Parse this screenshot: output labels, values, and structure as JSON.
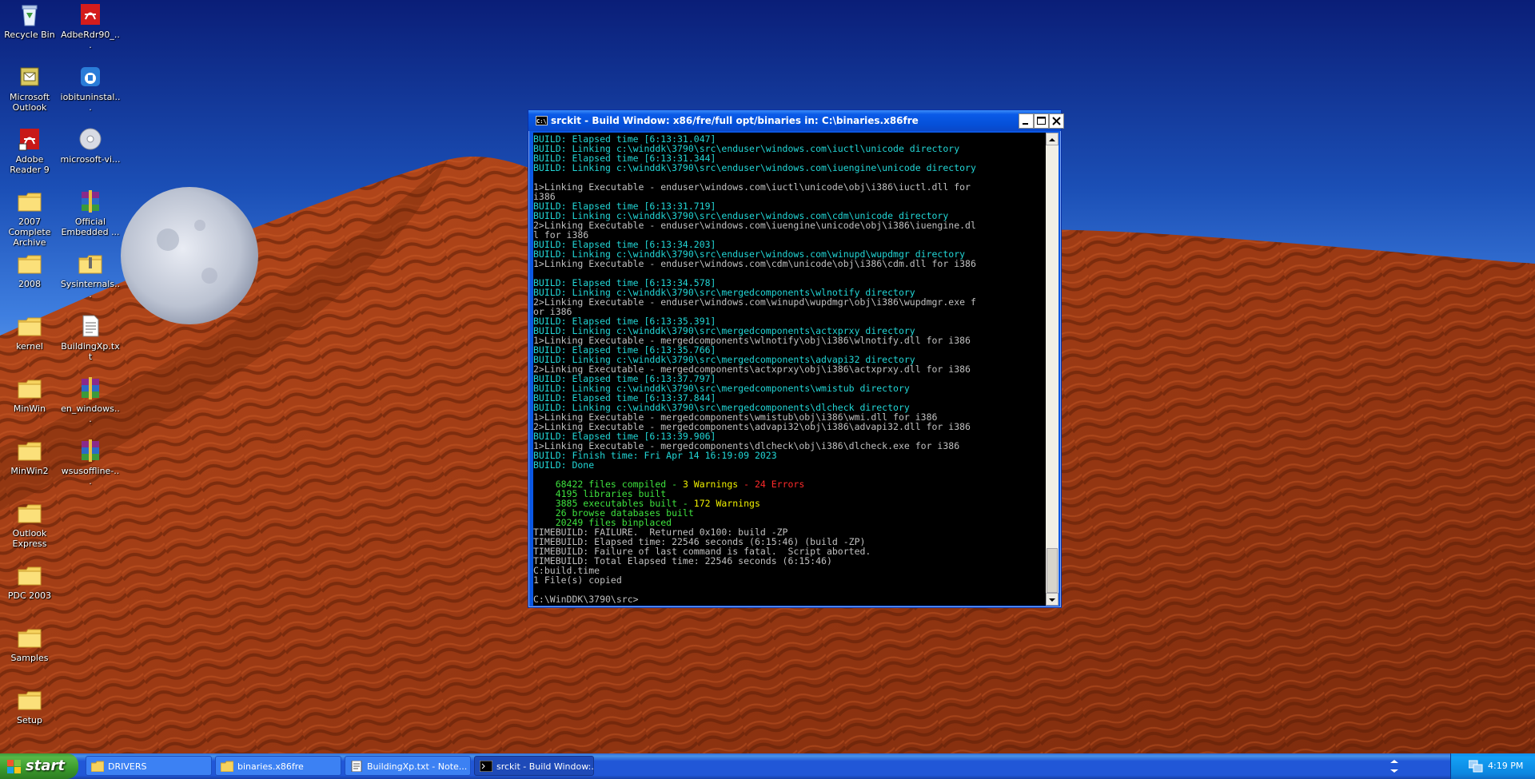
{
  "desktop": {
    "icons": [
      {
        "label": "Recycle Bin",
        "icon": "recycle-bin-icon"
      },
      {
        "label": "AdbeRdr90_...",
        "icon": "adobe-installer-icon"
      },
      {
        "label": "Microsoft Outlook",
        "icon": "outlook-icon"
      },
      {
        "label": "iobituninstal...",
        "icon": "iobit-icon"
      },
      {
        "label": "Adobe Reader 9",
        "icon": "adobe-reader-icon"
      },
      {
        "label": "microsoft-vi...",
        "icon": "disc-image-icon"
      },
      {
        "label": "2007 Complete Archive",
        "icon": "folder-icon"
      },
      {
        "label": "Official Embedded ...",
        "icon": "winrar-archive-icon"
      },
      {
        "label": "2008",
        "icon": "folder-icon"
      },
      {
        "label": "Sysinternals...",
        "icon": "zip-folder-icon"
      },
      {
        "label": "kernel",
        "icon": "folder-icon"
      },
      {
        "label": "BuildingXp.txt",
        "icon": "text-file-icon"
      },
      {
        "label": "MinWin",
        "icon": "folder-icon"
      },
      {
        "label": "en_windows...",
        "icon": "winrar-archive-icon"
      },
      {
        "label": "MinWin2",
        "icon": "folder-icon"
      },
      {
        "label": "wsusoffline-...",
        "icon": "winrar-archive-icon"
      },
      {
        "label": "Outlook Express",
        "icon": "folder-icon"
      },
      {
        "label": "PDC 2003",
        "icon": "folder-icon"
      },
      {
        "label": "Samples",
        "icon": "folder-icon"
      },
      {
        "label": "Setup",
        "icon": "folder-icon"
      }
    ]
  },
  "window": {
    "title": "srckit - Build Window: x86/fre/full opt/binaries in: C:\\binaries.x86fre",
    "icon_text": "C:\\",
    "console_lines": [
      {
        "t": "BUILD: Elapsed time [6:13:31.047]",
        "c": "cyan"
      },
      {
        "t": "BUILD: Linking c:\\winddk\\3790\\src\\enduser\\windows.com\\iuctl\\unicode directory",
        "c": "cyan"
      },
      {
        "t": "BUILD: Elapsed time [6:13:31.344]",
        "c": "cyan"
      },
      {
        "t": "BUILD: Linking c:\\winddk\\3790\\src\\enduser\\windows.com\\iuengine\\unicode directory",
        "c": "cyan"
      },
      {
        "t": "",
        "c": "gray"
      },
      {
        "t": "1>Linking Executable - enduser\\windows.com\\iuctl\\unicode\\obj\\i386\\iuctl.dll for",
        "c": "gray"
      },
      {
        "t": "i386",
        "c": "gray"
      },
      {
        "t": "BUILD: Elapsed time [6:13:31.719]",
        "c": "cyan"
      },
      {
        "t": "BUILD: Linking c:\\winddk\\3790\\src\\enduser\\windows.com\\cdm\\unicode directory",
        "c": "cyan"
      },
      {
        "t": "2>Linking Executable - enduser\\windows.com\\iuengine\\unicode\\obj\\i386\\iuengine.dl",
        "c": "gray"
      },
      {
        "t": "l for i386",
        "c": "gray"
      },
      {
        "t": "BUILD: Elapsed time [6:13:34.203]",
        "c": "cyan"
      },
      {
        "t": "BUILD: Linking c:\\winddk\\3790\\src\\enduser\\windows.com\\winupd\\wupdmgr directory",
        "c": "cyan"
      },
      {
        "t": "1>Linking Executable - enduser\\windows.com\\cdm\\unicode\\obj\\i386\\cdm.dll for i386",
        "c": "gray"
      },
      {
        "t": "",
        "c": "gray"
      },
      {
        "t": "BUILD: Elapsed time [6:13:34.578]",
        "c": "cyan"
      },
      {
        "t": "BUILD: Linking c:\\winddk\\3790\\src\\mergedcomponents\\wlnotify directory",
        "c": "cyan"
      },
      {
        "t": "2>Linking Executable - enduser\\windows.com\\winupd\\wupdmgr\\obj\\i386\\wupdmgr.exe f",
        "c": "gray"
      },
      {
        "t": "or i386",
        "c": "gray"
      },
      {
        "t": "BUILD: Elapsed time [6:13:35.391]",
        "c": "cyan"
      },
      {
        "t": "BUILD: Linking c:\\winddk\\3790\\src\\mergedcomponents\\actxprxy directory",
        "c": "cyan"
      },
      {
        "t": "1>Linking Executable - mergedcomponents\\wlnotify\\obj\\i386\\wlnotify.dll for i386",
        "c": "gray"
      },
      {
        "t": "BUILD: Elapsed time [6:13:35.766]",
        "c": "cyan"
      },
      {
        "t": "BUILD: Linking c:\\winddk\\3790\\src\\mergedcomponents\\advapi32 directory",
        "c": "cyan"
      },
      {
        "t": "2>Linking Executable - mergedcomponents\\actxprxy\\obj\\i386\\actxprxy.dll for i386",
        "c": "gray"
      },
      {
        "t": "BUILD: Elapsed time [6:13:37.797]",
        "c": "cyan"
      },
      {
        "t": "BUILD: Linking c:\\winddk\\3790\\src\\mergedcomponents\\wmistub directory",
        "c": "cyan"
      },
      {
        "t": "BUILD: Elapsed time [6:13:37.844]",
        "c": "cyan"
      },
      {
        "t": "BUILD: Linking c:\\winddk\\3790\\src\\mergedcomponents\\dlcheck directory",
        "c": "cyan"
      },
      {
        "t": "1>Linking Executable - mergedcomponents\\wmistub\\obj\\i386\\wmi.dll for i386",
        "c": "gray"
      },
      {
        "t": "2>Linking Executable - mergedcomponents\\advapi32\\obj\\i386\\advapi32.dll for i386",
        "c": "gray"
      },
      {
        "t": "BUILD: Elapsed time [6:13:39.906]",
        "c": "cyan"
      },
      {
        "t": "1>Linking Executable - mergedcomponents\\dlcheck\\obj\\i386\\dlcheck.exe for i386",
        "c": "gray"
      },
      {
        "t": "BUILD: Finish time: Fri Apr 14 16:19:09 2023",
        "c": "cyan"
      },
      {
        "t": "BUILD: Done",
        "c": "cyan"
      },
      {
        "t": "",
        "c": "gray"
      },
      {
        "segs": [
          {
            "t": "    68422 files compiled - ",
            "c": "green"
          },
          {
            "t": "3 Warnings",
            "c": "yellow"
          },
          {
            "t": " - 24 Errors",
            "c": "red"
          }
        ]
      },
      {
        "t": "    4195 libraries built",
        "c": "green"
      },
      {
        "segs": [
          {
            "t": "    3885 executables built - ",
            "c": "green"
          },
          {
            "t": "172 Warnings",
            "c": "yellow"
          }
        ]
      },
      {
        "t": "    26 browse databases built",
        "c": "green"
      },
      {
        "t": "    20249 files binplaced",
        "c": "green"
      },
      {
        "t": "TIMEBUILD: FAILURE.  Returned 0x100: build -ZP",
        "c": "gray"
      },
      {
        "t": "TIMEBUILD: Elapsed time: 22546 seconds (6:15:46) (build -ZP)",
        "c": "gray"
      },
      {
        "t": "TIMEBUILD: Failure of last command is fatal.  Script aborted.",
        "c": "gray"
      },
      {
        "t": "TIMEBUILD: Total Elapsed time: 22546 seconds (6:15:46)",
        "c": "gray"
      },
      {
        "t": "C:build.time",
        "c": "gray"
      },
      {
        "t": "1 File(s) copied",
        "c": "gray"
      },
      {
        "t": "",
        "c": "gray"
      },
      {
        "t": "C:\\WinDDK\\3790\\src>",
        "c": "gray"
      }
    ]
  },
  "taskbar": {
    "start_label": "start",
    "tasks": [
      {
        "label": "DRIVERS",
        "icon": "folder-icon",
        "active": false
      },
      {
        "label": "binaries.x86fre",
        "icon": "folder-icon",
        "active": false
      },
      {
        "label": "BuildingXp.txt - Note...",
        "icon": "notepad-icon",
        "active": false
      },
      {
        "label": "srckit - Build Window:...",
        "icon": "console-icon",
        "active": true
      }
    ],
    "clock": "4:19 PM"
  },
  "colors": {
    "cyan": "#22d6d6",
    "gray": "#c0c0c0",
    "green": "#3ee23e",
    "yellow": "#f0f000",
    "red": "#ff2a2a",
    "xp_blue": "#0b57e3",
    "start_green": "#3a9a2c"
  }
}
